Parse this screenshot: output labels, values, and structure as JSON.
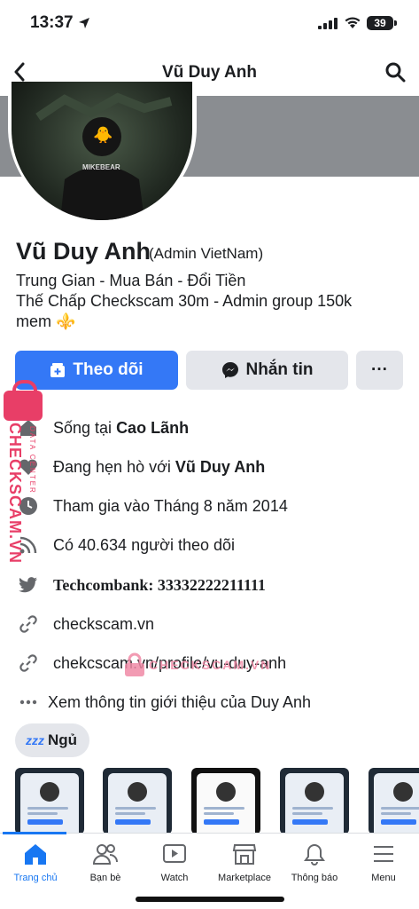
{
  "status_bar": {
    "time": "13:37",
    "battery": "39"
  },
  "header": {
    "title": "Vũ Duy Anh"
  },
  "profile": {
    "avatar_shirt_text": "MIKEBEAR",
    "name": "Vũ Duy Anh",
    "subtitle": "(Admin VietNam)",
    "bio": [
      "Trung Gian - Mua Bán - Đổi Tiền",
      "Thế Chấp Checkscam 30m - Admin group 150k",
      "mem ⚜️"
    ]
  },
  "actions": {
    "follow_label": "Theo dõi",
    "message_label": "Nhắn tin",
    "more_label": "···"
  },
  "info": {
    "lives_prefix": "Sống tại ",
    "lives_place": "Cao Lãnh",
    "relationship_prefix": "Đang hẹn hò với ",
    "relationship_person": "Vũ Duy Anh",
    "joined": "Tham gia vào Tháng 8 năm 2014",
    "followers": "Có 40.634 người theo dõi",
    "bank": "Techcombank: 33332222211111",
    "link1": "checkscam.vn",
    "link2": "chekcscam.vn/profile/vu-duy-anh",
    "about": "Xem thông tin giới thiệu của Duy Anh"
  },
  "status_chip": {
    "icon": "zzz",
    "label": "Ngủ"
  },
  "watermarks": {
    "side": "CHECKSCAM.VN",
    "side_small": "DATA CENTER",
    "center": "CHECKSCAM.VN"
  },
  "tabs": [
    {
      "label": "Trang chủ",
      "icon": "home-icon",
      "active": true
    },
    {
      "label": "Bạn bè",
      "icon": "friends-icon"
    },
    {
      "label": "Watch",
      "icon": "watch-icon"
    },
    {
      "label": "Marketplace",
      "icon": "marketplace-icon"
    },
    {
      "label": "Thông báo",
      "icon": "bell-icon"
    },
    {
      "label": "Menu",
      "icon": "menu-icon"
    }
  ],
  "colors": {
    "primary": "#3478f6",
    "button_gray": "#e4e6eb",
    "cover_gray": "#8a8d91",
    "watermark": "#e83e67"
  }
}
